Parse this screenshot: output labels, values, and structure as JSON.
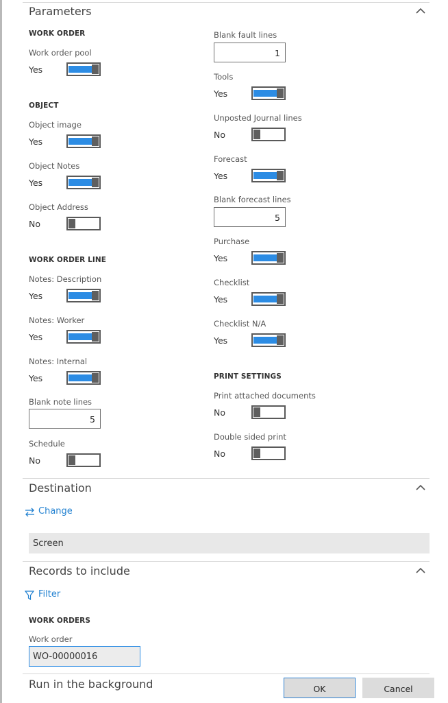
{
  "parameters": {
    "title": "Parameters",
    "left": {
      "work_order_head": "WORK ORDER",
      "work_order_pool": {
        "label": "Work order pool",
        "value": "Yes",
        "on": true
      },
      "object_head": "OBJECT",
      "object_image": {
        "label": "Object image",
        "value": "Yes",
        "on": true
      },
      "object_notes": {
        "label": "Object Notes",
        "value": "Yes",
        "on": true
      },
      "object_address": {
        "label": "Object Address",
        "value": "No",
        "on": false
      },
      "line_head": "WORK ORDER LINE",
      "notes_description": {
        "label": "Notes: Description",
        "value": "Yes",
        "on": true
      },
      "notes_worker": {
        "label": "Notes: Worker",
        "value": "Yes",
        "on": true
      },
      "notes_internal": {
        "label": "Notes: Internal",
        "value": "Yes",
        "on": true
      },
      "blank_note_lines": {
        "label": "Blank note lines",
        "value": "5"
      },
      "schedule": {
        "label": "Schedule",
        "value": "No",
        "on": false
      }
    },
    "right": {
      "blank_fault_lines": {
        "label": "Blank fault lines",
        "value": "1"
      },
      "tools": {
        "label": "Tools",
        "value": "Yes",
        "on": true
      },
      "unposted_journal": {
        "label": "Unposted Journal lines",
        "value": "No",
        "on": false
      },
      "forecast": {
        "label": "Forecast",
        "value": "Yes",
        "on": true
      },
      "blank_forecast_lines": {
        "label": "Blank forecast lines",
        "value": "5"
      },
      "purchase": {
        "label": "Purchase",
        "value": "Yes",
        "on": true
      },
      "checklist": {
        "label": "Checklist",
        "value": "Yes",
        "on": true
      },
      "checklist_na": {
        "label": "Checklist N/A",
        "value": "Yes",
        "on": true
      },
      "print_head": "PRINT SETTINGS",
      "print_attached": {
        "label": "Print attached documents",
        "value": "No",
        "on": false
      },
      "double_sided": {
        "label": "Double sided print",
        "value": "No",
        "on": false
      }
    }
  },
  "destination": {
    "title": "Destination",
    "change_label": "Change",
    "value": "Screen"
  },
  "records": {
    "title": "Records to include",
    "filter_label": "Filter",
    "group_head": "WORK ORDERS",
    "work_order_label": "Work order",
    "work_order_value": "WO-00000016"
  },
  "footer": {
    "run_background": "Run in the background",
    "ok_label": "OK",
    "cancel_label": "Cancel"
  },
  "colors": {
    "accent": "#2c8ce4",
    "link": "#1e7fd0"
  }
}
